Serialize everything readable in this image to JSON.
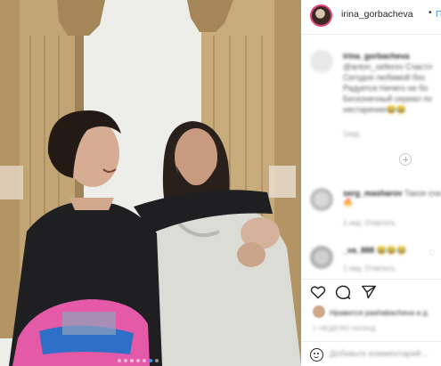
{
  "post": {
    "owner_username": "irina_gorbacheva",
    "separator": "•",
    "follow_label": "По",
    "image_dots": {
      "count": 7,
      "active_index": 5
    }
  },
  "caption": {
    "username": "irina_gorbacheva",
    "lines": [
      "@anton_sellerov Счастл",
      "Сегодня любимой бос",
      "Радуется Ничего не бо",
      "Бесконечный сериал по",
      "нестарение😂😂"
    ],
    "meta": "1нед."
  },
  "comments": [
    {
      "username": "serg_masharov",
      "text": "Такое сча",
      "emoji": "🔥",
      "meta": "1 нед.  Ответить"
    },
    {
      "username": "_va_888",
      "text": "😂😂😂",
      "meta": "1 нед.  Ответить"
    }
  ],
  "likes": {
    "text": "Нравится pashabacheva и д",
    "time": "1 НЕДЕЛЮ НАЗАД"
  },
  "add_comment": {
    "placeholder": "Добавьте комментарий..."
  },
  "icons": [
    "heart-icon",
    "comment-icon",
    "share-icon",
    "smile-icon",
    "add-circle-icon"
  ],
  "colors": {
    "link": "#3897f0",
    "story_ring": "#e2457a",
    "active_dot": "#2f96f0"
  }
}
